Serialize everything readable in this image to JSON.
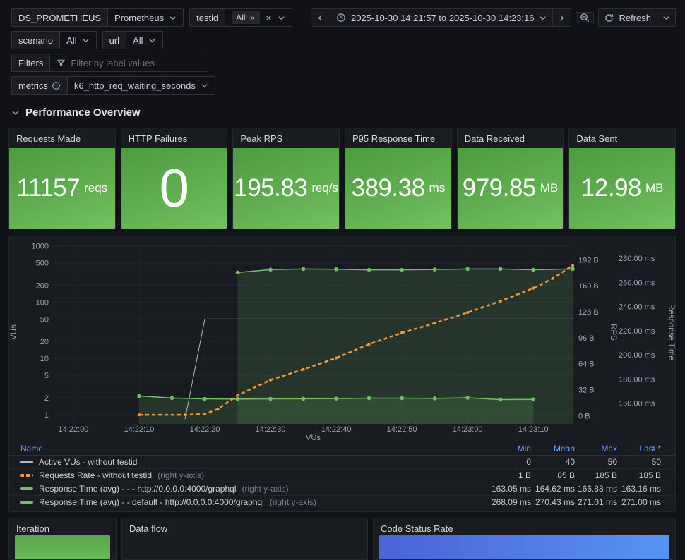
{
  "controls": {
    "ds": {
      "label": "DS_PROMETHEUS",
      "value": "Prometheus"
    },
    "testid": {
      "label": "testid",
      "chip": "All"
    },
    "scenario": {
      "label": "scenario",
      "value": "All"
    },
    "url": {
      "label": "url",
      "value": "All"
    },
    "filters": {
      "label": "Filters",
      "placeholder": "Filter by label values"
    },
    "metrics": {
      "label": "metrics",
      "value": "k6_http_req_waiting_seconds"
    },
    "time_range": "2025-10-30 14:21:57 to 2025-10-30 14:23:16",
    "refresh_label": "Refresh"
  },
  "section": {
    "title": "Performance Overview"
  },
  "stats": [
    {
      "title": "Requests Made",
      "value": "11157",
      "unit": "reqs"
    },
    {
      "title": "HTTP Failures",
      "value": "0",
      "unit": ""
    },
    {
      "title": "Peak RPS",
      "value": "195.83",
      "unit": "req/s"
    },
    {
      "title": "P95 Response Time",
      "value": "389.38",
      "unit": "ms"
    },
    {
      "title": "Data Received",
      "value": "979.85",
      "unit": "MB"
    },
    {
      "title": "Data Sent",
      "value": "12.98",
      "unit": "MB"
    }
  ],
  "chart_data": {
    "type": "line",
    "x_axis_label": "VUs",
    "x_range_seconds": [
      0,
      79
    ],
    "x_ticks": [
      {
        "t": 3,
        "label": "14:22:00"
      },
      {
        "t": 13,
        "label": "14:22:10"
      },
      {
        "t": 23,
        "label": "14:22:20"
      },
      {
        "t": 33,
        "label": "14:22:30"
      },
      {
        "t": 43,
        "label": "14:22:40"
      },
      {
        "t": 53,
        "label": "14:22:50"
      },
      {
        "t": 63,
        "label": "14:23:00"
      },
      {
        "t": 73,
        "label": "14:23:10"
      }
    ],
    "left_axis": {
      "label": "VUs",
      "scale": "log",
      "ticks": [
        1000,
        500,
        200,
        100,
        50,
        20,
        10,
        5,
        2,
        1
      ]
    },
    "right_axis_rps": {
      "label": "RPS",
      "scale": "linear",
      "ticks": [
        {
          "value": 192,
          "label": "192 B"
        },
        {
          "value": 160,
          "label": "160 B"
        },
        {
          "value": 128,
          "label": "128 B"
        },
        {
          "value": 96,
          "label": "96 B"
        },
        {
          "value": 64,
          "label": "64 B"
        },
        {
          "value": 32,
          "label": "32 B"
        },
        {
          "value": 0,
          "label": "0 B"
        }
      ]
    },
    "right_axis_ms": {
      "label": "Response Time",
      "scale": "linear",
      "ticks": [
        {
          "value": 280,
          "label": "280.00 ms"
        },
        {
          "value": 260,
          "label": "260.00 ms"
        },
        {
          "value": 240,
          "label": "240.00 ms"
        },
        {
          "value": 220,
          "label": "220.00 ms"
        },
        {
          "value": 200,
          "label": "200.00 ms"
        },
        {
          "value": 180,
          "label": "180.00 ms"
        },
        {
          "value": 160,
          "label": "160.00 ms"
        }
      ]
    },
    "series": [
      {
        "name": "Active VUs - without testid",
        "axis": "vus",
        "color": "#B6B8BE",
        "width": 1,
        "dash": false,
        "points": false,
        "fill": false,
        "data": [
          [
            20,
            0.8
          ],
          [
            23,
            50
          ],
          [
            79,
            50
          ]
        ]
      },
      {
        "name": "Response Time (avg) - - - http://0.0.0.0:4000/graphql",
        "axis": "ms",
        "color": "#73BF69",
        "width": 1.5,
        "dash": false,
        "points": true,
        "fill": true,
        "data": [
          [
            13,
            166
          ],
          [
            18,
            164.3
          ],
          [
            23,
            163.6
          ],
          [
            28,
            163.5
          ],
          [
            33,
            163.6
          ],
          [
            38,
            163.7
          ],
          [
            43,
            163.8
          ],
          [
            48,
            164.2
          ],
          [
            53,
            164.2
          ],
          [
            58,
            164.0
          ],
          [
            63,
            164.5
          ],
          [
            68,
            163.0
          ],
          [
            73,
            163.2
          ]
        ]
      },
      {
        "name": "Response Time (avg) - - default - http://0.0.0.0:4000/graphql",
        "axis": "ms",
        "color": "#73BF69",
        "width": 1.5,
        "dash": false,
        "points": true,
        "fill": true,
        "data": [
          [
            28,
            268.1
          ],
          [
            33,
            270.5
          ],
          [
            38,
            271
          ],
          [
            43,
            270.8
          ],
          [
            48,
            270.3
          ],
          [
            53,
            270.3
          ],
          [
            58,
            270.6
          ],
          [
            63,
            271
          ],
          [
            68,
            271
          ],
          [
            73,
            270.4
          ],
          [
            79,
            271
          ]
        ]
      },
      {
        "name": "Requests Rate - without testid",
        "axis": "rps",
        "color": "#FF9830",
        "width": 2.5,
        "dash": true,
        "points": true,
        "point_r": 2,
        "data": [
          [
            13,
            1
          ],
          [
            20,
            1
          ],
          [
            23,
            2
          ],
          [
            25,
            8
          ],
          [
            28,
            25
          ],
          [
            33,
            44
          ],
          [
            38,
            57
          ],
          [
            43,
            71
          ],
          [
            48,
            88
          ],
          [
            53,
            102
          ],
          [
            58,
            114
          ],
          [
            63,
            127
          ],
          [
            68,
            141
          ],
          [
            73,
            157
          ],
          [
            76,
            169
          ],
          [
            79,
            185
          ]
        ]
      }
    ]
  },
  "legend": {
    "name_label": "Name",
    "columns": [
      "Min",
      "Mean",
      "Max",
      "Last *"
    ],
    "rows": [
      {
        "name": "Active VUs - without testid",
        "suffix": "",
        "swatch": "#B6B8BE",
        "dashed": false,
        "min": "0",
        "mean": "40",
        "max": "50",
        "last": "50"
      },
      {
        "name": "Requests Rate - without testid",
        "suffix": "(right y-axis)",
        "swatch": "#FF9830",
        "dashed": true,
        "min": "1 B",
        "mean": "85 B",
        "max": "185 B",
        "last": "185 B"
      },
      {
        "name": "Response Time (avg) - - - http://0.0.0.0:4000/graphql",
        "suffix": "(right y-axis)",
        "swatch": "#73BF69",
        "dashed": false,
        "min": "163.05 ms",
        "mean": "164.62 ms",
        "max": "166.88 ms",
        "last": "163.16 ms"
      },
      {
        "name": "Response Time (avg) - - default - http://0.0.0.0:4000/graphql",
        "suffix": "(right y-axis)",
        "swatch": "#73BF69",
        "dashed": false,
        "min": "268.09 ms",
        "mean": "270.43 ms",
        "max": "271.01 ms",
        "last": "271.00 ms"
      }
    ]
  },
  "bottom_panels": {
    "iteration": "Iteration",
    "data_flow": "Data flow",
    "code_status_rate": "Code Status Rate"
  },
  "colors": {
    "background": "#111217",
    "panel": "#181b1f",
    "green_series": "#73BF69",
    "orange_series": "#FF9830",
    "gray_series": "#B6B8BE",
    "stat_gradient_start": "#4D9C3F",
    "stat_gradient_end": "#74C163",
    "blue_bar_start": "#4A63D8",
    "blue_bar_end": "#5794F2",
    "link_blue": "#6E9FFF"
  }
}
